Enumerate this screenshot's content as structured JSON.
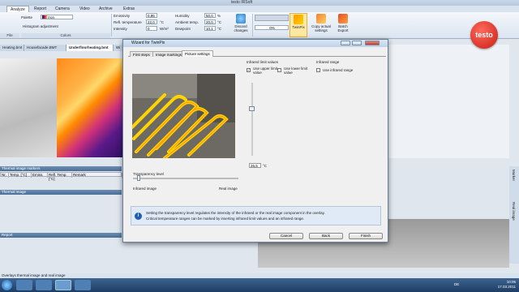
{
  "app": {
    "window_title": "testo IRSoft",
    "status_text": "Overlays thermal image and real image"
  },
  "ribbon": {
    "tabs": [
      "Analyze",
      "Report",
      "Camera",
      "Video",
      "Archive",
      "Extras"
    ],
    "palette_label": "Palette",
    "palette_value": "Iron",
    "histogram_label": "Histogram adjustment",
    "group_colors": "Colors",
    "group_file": "File",
    "emissivity_label": "Emissivity",
    "emissivity_value": "0,95",
    "refl_temp_label": "Refl. temperature",
    "refl_temp_value": "22,0",
    "refl_temp_unit": "°C",
    "intensity_label": "Intensity",
    "intensity_value": "0",
    "intensity_unit": "W/m²",
    "humidity_label": "Humidity",
    "humidity_value": "50,0",
    "humidity_unit": "%",
    "ambient_label": "Ambient temp.",
    "ambient_value": "20,0",
    "ambient_unit": "°C",
    "dewpoint_label": "Dewpoint",
    "dewpoint_value": "10,1",
    "dewpoint_unit": "°C",
    "discard_label": "Discard changes",
    "twinpix_label": "TwinPix",
    "copy_label": "Copy actual settings",
    "batch_label": "Batch Export",
    "player_value": "0%",
    "logo": "testo"
  },
  "doc_tabs": [
    "Heating.bmt",
    "Housefacade.BMT",
    "Underfloorheating.bmt",
    "Wi"
  ],
  "panels": {
    "thermal_image_markers": "Thermal image markers",
    "image": "Thermal image",
    "report": "Report"
  },
  "marker_columns": [
    "Nr.",
    "Temp. [°C]",
    "Emiss.",
    "Refl. Temp. [°C]",
    "Remark"
  ],
  "side_tabs": {
    "marker": "Marker",
    "real_image": "Real image"
  },
  "dialog": {
    "title": "Wizard for TwinPix",
    "tabs": [
      "First steps",
      "Image markings",
      "Picture settings"
    ],
    "limits_heading": "Infrared limit values",
    "use_upper": "Use upper limit value",
    "use_upper_checked": true,
    "use_lower": "Use lower limit value",
    "use_lower_checked": false,
    "range_heading": "Infrared range",
    "use_range": "Use infrared range",
    "use_range_checked": false,
    "temp_value": "26,5",
    "temp_unit": "°C",
    "transparency_label": "Transparency level",
    "transparency_value": 0.05,
    "infrared_image": "Infrared image",
    "real_image": "Real image",
    "info_line1": "Setting the transparency level regulates the intensity of the infrared or the real image component in the overlay.",
    "info_line2": "Critical temperature ranges can be marked by inserting infrared limit values and an infrared range.",
    "cancel": "Cancel",
    "back": "Back",
    "finish": "Finish"
  },
  "taskbar": {
    "lang": "DE",
    "time": "10:05",
    "date": "17.03.2011"
  }
}
